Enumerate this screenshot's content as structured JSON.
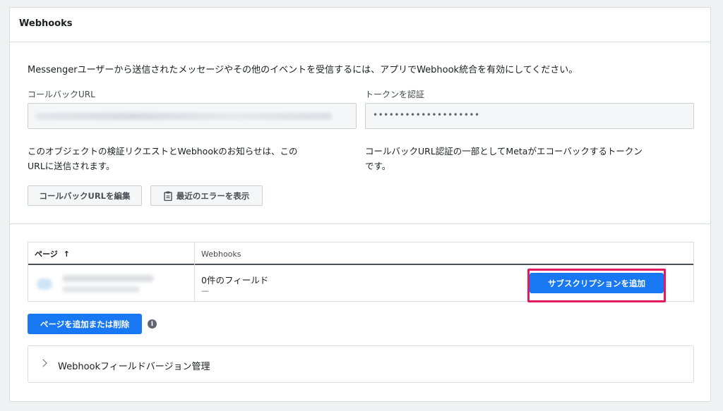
{
  "card": {
    "title": "Webhooks"
  },
  "intro": {
    "description": "Messengerユーザーから送信されたメッセージやその他のイベントを受信するには、アプリでWebhook統合を有効にしてください。"
  },
  "callback": {
    "label": "コールバックURL",
    "help": "このオブジェクトの検証リクエストとWebhookのお知らせは、このURLに送信されます。",
    "help_line1": "このオブジェクトの検証リクエストとWebhookのお知らせは、この",
    "help_line2": "URLに送信されます。"
  },
  "token": {
    "label": "トークンを認証",
    "masked_value": "••••••••••••••••••••••••••••••••••••••••",
    "help_line1": "コールバックURL認証の一部としてMetaがエコーバックするトークン",
    "help_line2": "です。"
  },
  "buttons": {
    "edit_callback": "コールバックURLを編集",
    "show_errors": "最近のエラーを表示",
    "add_subscription": "サブスクリプションを追加",
    "add_remove_pages": "ページを追加または削除"
  },
  "table": {
    "headers": {
      "page": "ページ",
      "sort_arrow": "↑",
      "webhooks": "Webhooks"
    },
    "rows": [
      {
        "fields_count": "0件のフィールド",
        "fields_detail": "—"
      }
    ]
  },
  "accordion": {
    "label": "Webhookフィールドバージョン管理"
  },
  "colors": {
    "primary": "#1877f2",
    "highlight": "#e8185f"
  }
}
